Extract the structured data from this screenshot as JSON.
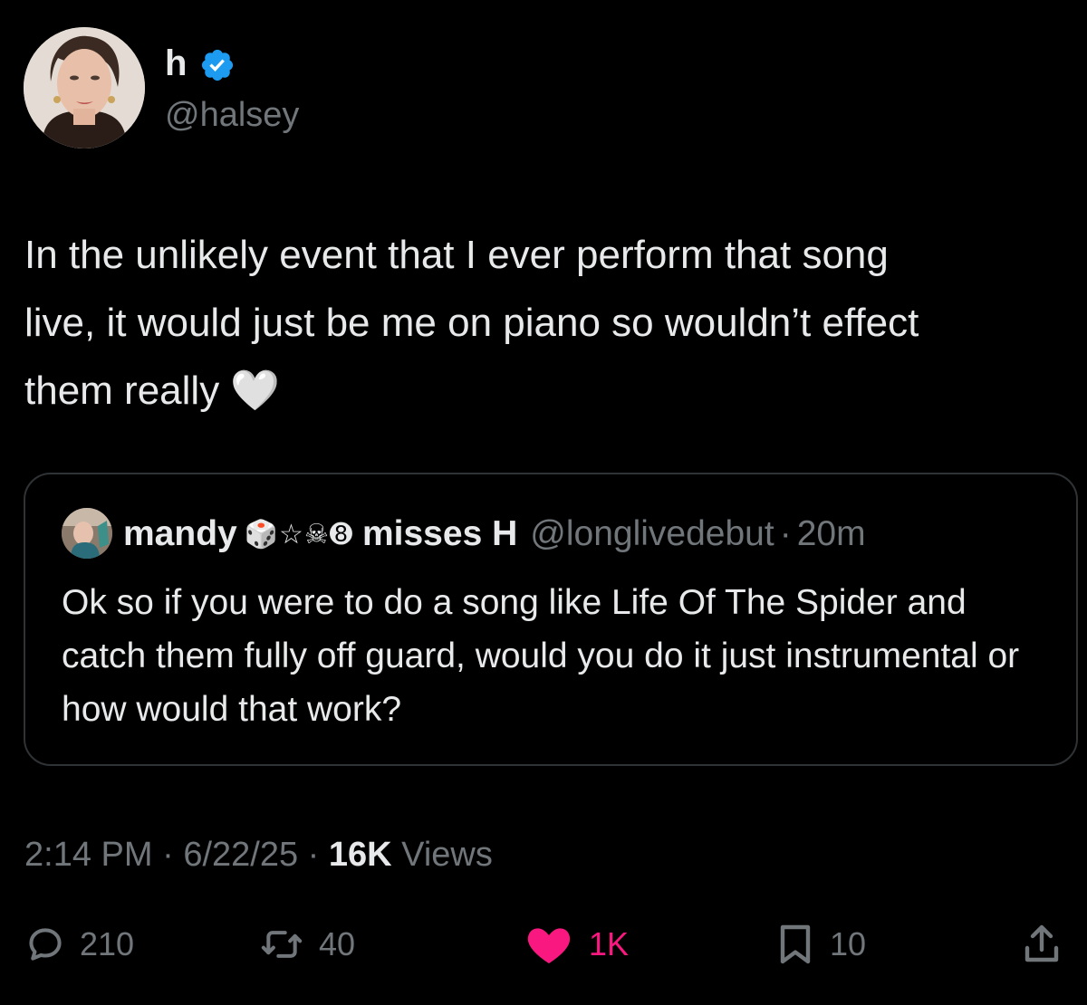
{
  "tweet": {
    "author": {
      "display_name": "h",
      "handle": "@halsey",
      "verified": true
    },
    "text": "In the unlikely event that I ever perform that song\nlive, it would just be me on piano so wouldn’t effect\nthem really 🤍",
    "quoted_tweet": {
      "display_name": "mandy",
      "name_emojis": "🎲☆☠➑",
      "name_suffix": "misses H",
      "handle": "@longlivedebut",
      "separator": "·",
      "time": "20m",
      "text": "Ok so if you were to do a song like Life Of The Spider and catch them fully off guard, would you do it just instrumental or how would that work?"
    },
    "meta": {
      "time": "2:14 PM",
      "separator": "·",
      "date": "6/22/25",
      "views_count": "16K",
      "views_label": "Views"
    },
    "actions": {
      "replies": "210",
      "retweets": "40",
      "likes": "1K",
      "bookmarks": "10"
    }
  },
  "icons": {
    "verified": "verified-badge-icon",
    "reply": "reply-icon",
    "retweet": "retweet-icon",
    "like": "heart-icon",
    "bookmark": "bookmark-icon",
    "share": "share-icon"
  },
  "colors": {
    "background": "#000000",
    "text_primary": "#e7e9ea",
    "text_secondary": "#71767b",
    "verified_blue": "#1d9bf0",
    "like_pink": "#f91880",
    "border": "#2f3336"
  }
}
